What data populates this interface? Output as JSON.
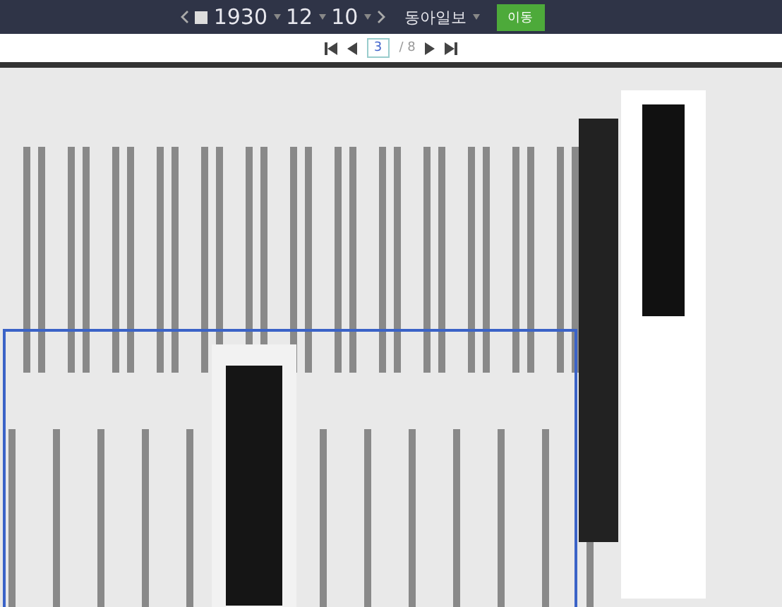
{
  "toolbar": {
    "year": "1930",
    "month": "12",
    "day": "10",
    "paper": "동아일보",
    "go_button": "이동"
  },
  "pager": {
    "page": "3",
    "total": "/ 8"
  }
}
